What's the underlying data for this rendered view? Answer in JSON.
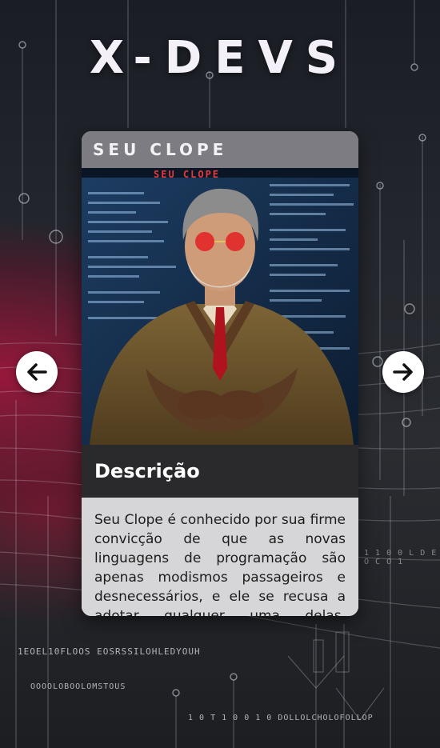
{
  "app": {
    "title": "X-DEVS"
  },
  "character": {
    "name": "SEU CLOPE",
    "image_caption": "SEU CLOPE"
  },
  "description": {
    "heading": "Descrição",
    "text": "Seu Clope é conhecido por sua firme convicção de que as novas linguagens de programação são apenas modismos passageiros e desnecessários, e ele se recusa a adotar qualquer uma delas, alegando"
  },
  "navigation": {
    "prev_icon": "arrow-left-icon",
    "next_icon": "arrow-right-icon"
  },
  "background_text": {
    "line1": "1EOEL10FLOOS EOSRSSILOHLEDYOUH",
    "line2": "OOOOLOBOOLOMSTOUS",
    "line3": "1 0 T 1 0 0 1 0 DOLLOLCHOLOFOLLOP",
    "line4": "1 1 0 0 L D E O C O 1"
  },
  "colors": {
    "accent_red": "#a8143c",
    "card_header": "#7d7c82",
    "desc_bar": "#2a2a2c"
  }
}
